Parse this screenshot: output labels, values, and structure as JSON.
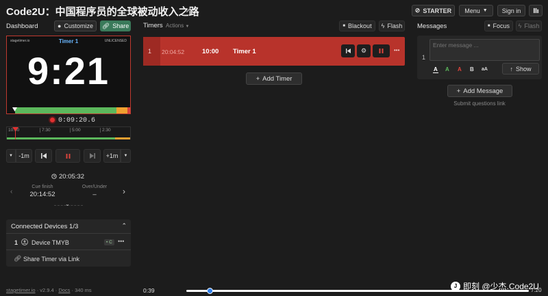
{
  "header": {
    "title": "Code2U：中国程序员的全球被动收入之路",
    "starter_label": "STARTER",
    "menu_label": "Menu",
    "signin_label": "Sign in"
  },
  "dashboard": {
    "title": "Dashboard",
    "customize_label": "Customize",
    "share_label": "Share",
    "preview": {
      "brand": "stagetimer.io",
      "timer_name": "Timer 1",
      "license": "UNLICENSED",
      "time": "9:21",
      "progress": 0.88
    },
    "elapsed": "0:09:20.6",
    "timeline_ticks": [
      "10:00",
      "7:30",
      "5:00",
      "2:30"
    ],
    "controls": {
      "minus_label": "-1m",
      "plus_label": "+1m"
    },
    "clock": "20:05:32",
    "cue_finish_label": "Cue finish",
    "cue_finish_value": "20:14:52",
    "over_under_label": "Over/Under",
    "over_under_value": "–"
  },
  "devices": {
    "title": "Connected Devices",
    "count": "1/3",
    "device_index": "1",
    "device_name": "Device TMYB",
    "device_badge": "• C",
    "share_link_label": "Share Timer via Link"
  },
  "timers": {
    "title": "Timers",
    "actions_label": "Actions",
    "blackout_label": "Blackout",
    "flash_label": "Flash",
    "row": {
      "index": "1",
      "start": "20:04:52",
      "duration": "10:00",
      "name": "Timer 1"
    },
    "add_label": "Add Timer"
  },
  "messages": {
    "title": "Messages",
    "focus_label": "Focus",
    "flash_label": "Flash",
    "index": "1",
    "placeholder": "Enter message ...",
    "fmt_a1": "A",
    "fmt_a2": "A",
    "fmt_a3": "A",
    "fmt_b": "B",
    "fmt_case": "aA",
    "show_label": "Show",
    "add_label": "Add Message",
    "submit_link": "Submit questions link"
  },
  "footer": {
    "brand": "stagetimer.io",
    "version": "v2.9.4",
    "docs": "Docs",
    "latency": "340 ms",
    "elapsed": "0:39",
    "end": "7:20",
    "playback_progress": 0.06,
    "watermark": "即刻 @少杰.Code2U"
  },
  "colors": {
    "accent_red": "#b8332b",
    "accent_green": "#5cb85c",
    "accent_orange": "#f0a030",
    "share_green": "#3a7a5a"
  }
}
